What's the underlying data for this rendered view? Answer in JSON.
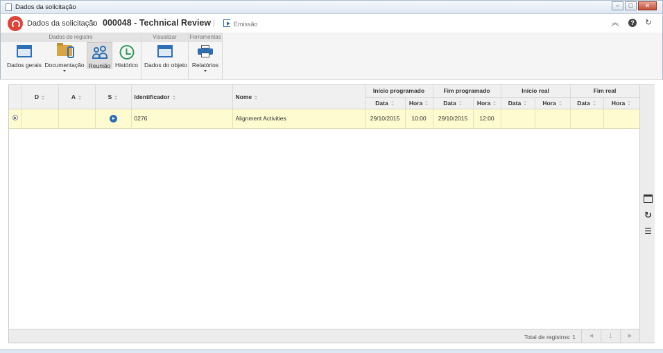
{
  "window": {
    "title": "Dados da solicitação"
  },
  "header": {
    "breadcrumb_root": "Dados da solicitação",
    "breadcrumb_current": "000048 - Technical Review",
    "emission_label": "Emissão"
  },
  "ribbon": {
    "groups": [
      {
        "title": "Dados do registro"
      },
      {
        "title": "Visualizar"
      },
      {
        "title": "Ferramentas"
      }
    ],
    "buttons": {
      "dados_gerais": "Dados gerais",
      "documentacao": "Documentação",
      "reuniao": "Reunião",
      "historico": "Histórico",
      "dados_objeto": "Dados do objeto",
      "relatorios": "Relatórios"
    }
  },
  "grid": {
    "group_headers": {
      "inicio_programado": "Início programado",
      "fim_programado": "Fim programado",
      "inicio_real": "Início real",
      "fim_real": "Fim real"
    },
    "columns": {
      "d": "D",
      "a": "A",
      "s": "S",
      "identificador": "Identificador",
      "nome": "Nome",
      "data": "Data",
      "hora": "Hora"
    },
    "rows": [
      {
        "identificador": "0276",
        "nome": "Alignment Activities",
        "inicio_prog_data": "29/10/2015",
        "inicio_prog_hora": "10:00",
        "fim_prog_data": "29/10/2015",
        "fim_prog_hora": "12:00",
        "inicio_real_data": "",
        "inicio_real_hora": "",
        "fim_real_data": "",
        "fim_real_hora": "",
        "status_icon": "play-icon"
      }
    ],
    "footer": {
      "total": "Total de registros: 1",
      "page": "1"
    }
  },
  "colors": {
    "accent": "#2d6fb5",
    "selected_row": "#fdfbcf",
    "logo": "#e0433a",
    "history": "#2d9a5a"
  }
}
